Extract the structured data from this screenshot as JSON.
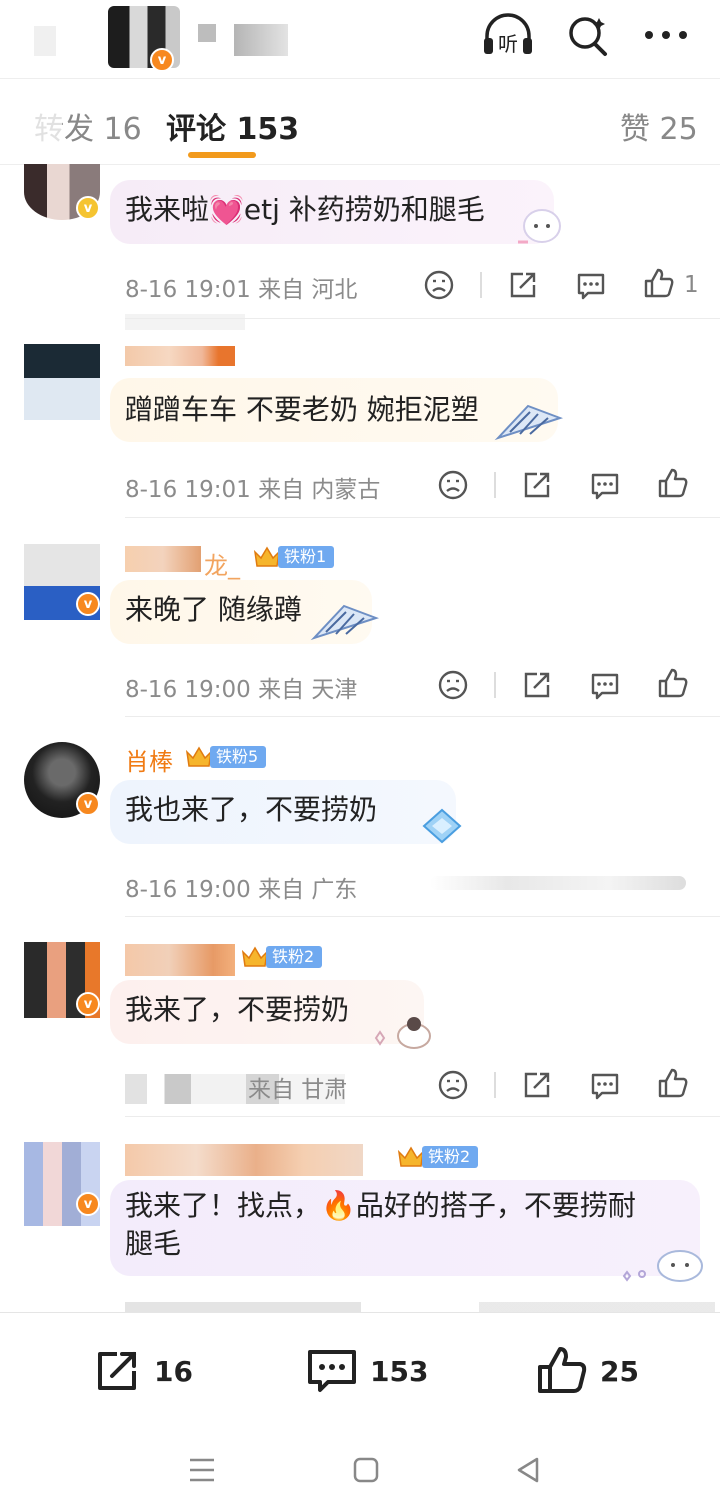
{
  "header": {
    "listen_label": "听"
  },
  "tabs": [
    {
      "label": "转发 16"
    },
    {
      "label": "评论 153"
    },
    {
      "label": "赞 25"
    }
  ],
  "comments": [
    {
      "text": "我来啦💓etj 补药捞奶和腿毛",
      "time": "8-16 19:01",
      "from": "来自 河北",
      "likes": "1"
    },
    {
      "text": "蹭蹭车车 不要老奶 婉拒泥塑",
      "time": "8-16 19:01",
      "from": "来自 内蒙古",
      "likes": ""
    },
    {
      "name_suffix": "龙_",
      "badge": "铁粉1",
      "text": "来晚了 随缘蹲",
      "time": "8-16 19:00",
      "from": "来自 天津",
      "likes": ""
    },
    {
      "name": "肖棒",
      "badge": "铁粉5",
      "text": "我也来了，不要捞奶",
      "time": "8-16 19:00",
      "from": "来自 广东",
      "likes": ""
    },
    {
      "badge": "铁粉2",
      "text": "我来了，不要捞奶",
      "from": "来自 甘肃",
      "likes": ""
    },
    {
      "badge": "铁粉2",
      "text_line1": "我来了！找点，🔥品好的搭子，不要捞耐",
      "text_line2": "腿毛"
    }
  ],
  "bottom_bar": {
    "repost_count": "16",
    "comment_count": "153",
    "like_count": "25"
  },
  "colors": {
    "accent": "#f29a1c",
    "username": "#f07b14",
    "fan_badge": "#6fa9f0",
    "verified": "#f7881f"
  }
}
